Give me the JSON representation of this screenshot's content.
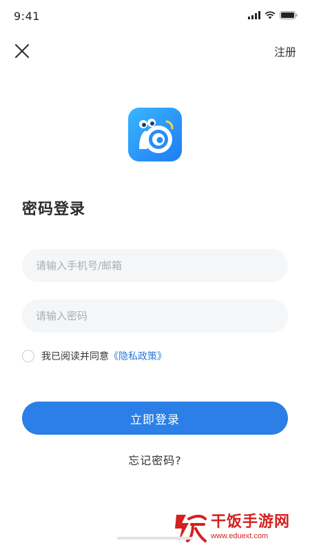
{
  "status_bar": {
    "time": "9:41"
  },
  "header": {
    "register_label": "注册"
  },
  "login": {
    "title": "密码登录",
    "account_placeholder": "请输入手机号/邮箱",
    "password_placeholder": "请输入密码",
    "agree_text": "我已阅读并同意",
    "privacy_link": "《隐私政策》",
    "submit_label": "立即登录",
    "forgot_label": "忘记密码?"
  },
  "watermark": {
    "name": "干饭手游网",
    "url": "www.eduext.com"
  },
  "colors": {
    "primary": "#2b7fe6",
    "link": "#2b7bd8",
    "input_bg": "#f5f6f8",
    "watermark": "#d42020"
  },
  "icons": {
    "close": "close-icon",
    "signal": "signal-icon",
    "wifi": "wifi-icon",
    "battery": "battery-icon",
    "logo": "snail-logo-icon"
  }
}
